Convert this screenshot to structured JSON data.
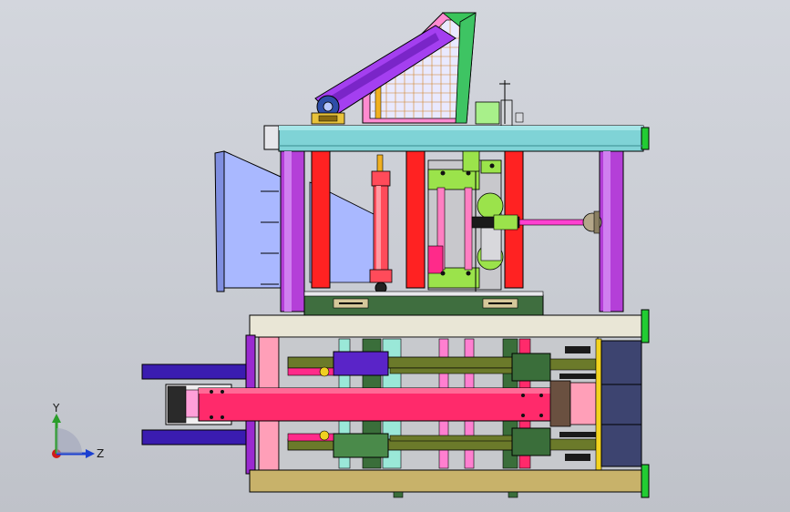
{
  "viewport": {
    "background_top": "#d3d6dd",
    "background_bottom": "#bfc2c9"
  },
  "triad": {
    "y_label": "Y",
    "z_label": "Z",
    "y_color": "#2a9d2a",
    "z_color": "#1a3fd1",
    "x_color": "#d11a1a"
  },
  "palette": {
    "frame_cyan": "#7fd3d6",
    "post_purple": "#b43fd8",
    "post_red": "#ff2222",
    "green_block": "#9be34b",
    "pink_beam": "#ff2a6b",
    "navy_rod": "#3a1cb0",
    "olive_rod": "#6b7a2a",
    "hopper_blue": "#a9b8ff",
    "base_tan": "#c8b26a",
    "slab_cream": "#e9e6d6",
    "dark_green": "#3f6e3f",
    "end_cap_green": "#22cc33"
  }
}
